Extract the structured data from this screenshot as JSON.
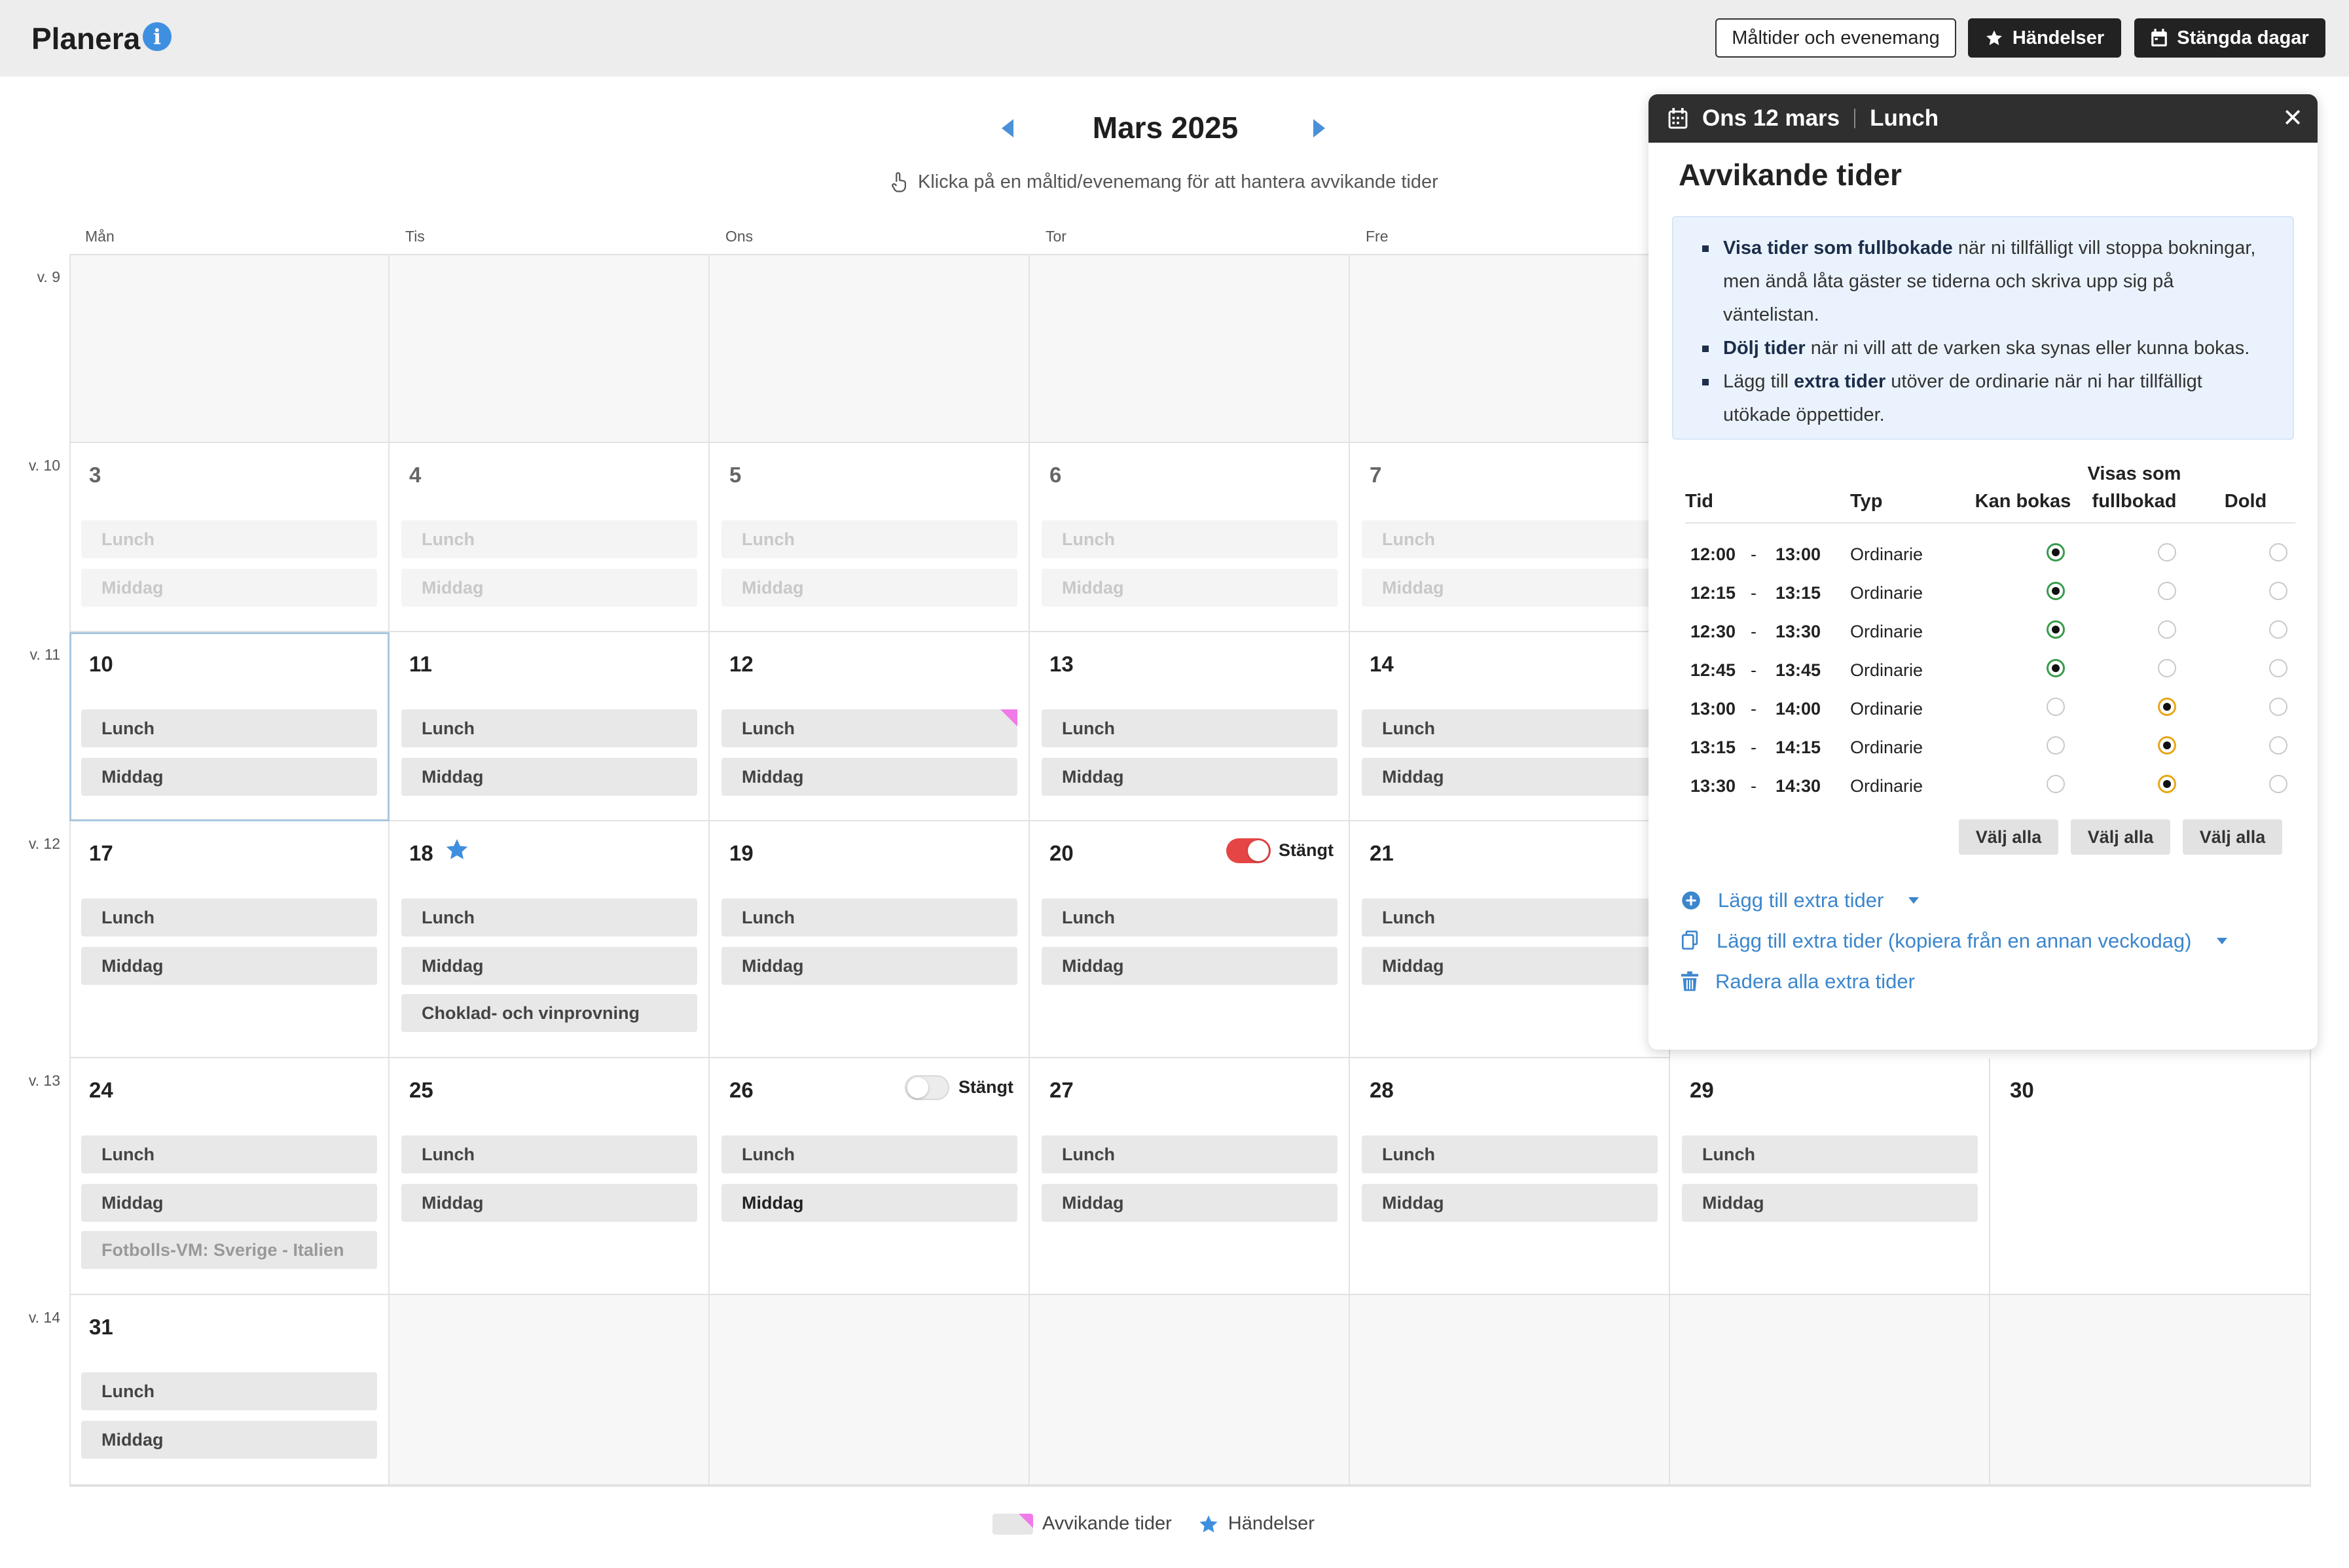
{
  "header": {
    "title": "Planera",
    "info_icon": "info-icon",
    "buttons": {
      "meals_events": "Måltider och evenemang",
      "events": "Händelser",
      "closed_days": "Stängda dagar"
    }
  },
  "calendar": {
    "month_title": "Mars 2025",
    "hint": "Klicka på en måltid/evenemang för att hantera avvikande tider",
    "day_headers": [
      "Mån",
      "Tis",
      "Ons",
      "Tor",
      "Fre"
    ],
    "weeks": [
      "v. 9",
      "v. 10",
      "v. 11",
      "v. 12",
      "v. 13",
      "v. 14"
    ],
    "days": {
      "d3": "3",
      "d4": "4",
      "d5": "5",
      "d6": "6",
      "d7": "7",
      "d10": "10",
      "d11": "11",
      "d12": "12",
      "d13": "13",
      "d14": "14",
      "d17": "17",
      "d18": "18",
      "d19": "19",
      "d20": "20",
      "d21": "21",
      "d24": "24",
      "d25": "25",
      "d26": "26",
      "d27": "27",
      "d28": "28",
      "d29": "29",
      "d30": "30",
      "d31": "31"
    },
    "meals": {
      "lunch": "Lunch",
      "dinner": "Middag"
    },
    "events": {
      "tasting": "Choklad- och vinprovning",
      "football": "Fotbolls-VM: Sverige - Italien"
    },
    "closed_label": "Stängt",
    "toggle_20_state": "on",
    "toggle_26_state": "off"
  },
  "legend": {
    "deviating": "Avvikande tider",
    "events": "Händelser"
  },
  "panel": {
    "date": "Ons 12 mars",
    "meal": "Lunch",
    "close_icon": "close-icon",
    "title": "Avvikande tider",
    "info": {
      "b1_strong": "Visa tider som fullbokade",
      "b1_text": " när ni tillfälligt vill stoppa bokningar, men ändå låta gäster se tiderna och skriva upp sig på väntelistan.",
      "b2_strong": "Dölj tider",
      "b2_text": " när ni vill att de varken ska synas eller kunna bokas.",
      "b3_pre": "Lägg till ",
      "b3_strong": "extra tider",
      "b3_text": " utöver de ordinarie när ni har tillfälligt utökade öppettider."
    },
    "table": {
      "headers": {
        "time": "Tid",
        "type": "Typ",
        "bookable": "Kan bokas",
        "full_1": "Visas som",
        "full_2": "fullbokad",
        "hidden": "Dold"
      },
      "rows": [
        {
          "start": "12:00",
          "end": "13:00",
          "type": "Ordinarie",
          "state": "bookable"
        },
        {
          "start": "12:15",
          "end": "13:15",
          "type": "Ordinarie",
          "state": "bookable"
        },
        {
          "start": "12:30",
          "end": "13:30",
          "type": "Ordinarie",
          "state": "bookable"
        },
        {
          "start": "12:45",
          "end": "13:45",
          "type": "Ordinarie",
          "state": "bookable"
        },
        {
          "start": "13:00",
          "end": "14:00",
          "type": "Ordinarie",
          "state": "full"
        },
        {
          "start": "13:15",
          "end": "14:15",
          "type": "Ordinarie",
          "state": "full"
        },
        {
          "start": "13:30",
          "end": "14:30",
          "type": "Ordinarie",
          "state": "full"
        }
      ],
      "dash": "-",
      "select_all": "Välj alla"
    },
    "actions": {
      "add_extra": "Lägg till extra tider",
      "add_extra_copy": "Lägg till extra tider (kopiera från en annan veckodag)",
      "delete_extra": "Radera alla extra tider"
    }
  },
  "colors": {
    "accent_blue": "#3b86cc",
    "deviating_flag": "#f07ae8",
    "toggle_on": "#e64545",
    "radio_bookable": "#3a9b4d",
    "radio_full": "#e8a61a",
    "panel_header": "#2f2f30"
  }
}
